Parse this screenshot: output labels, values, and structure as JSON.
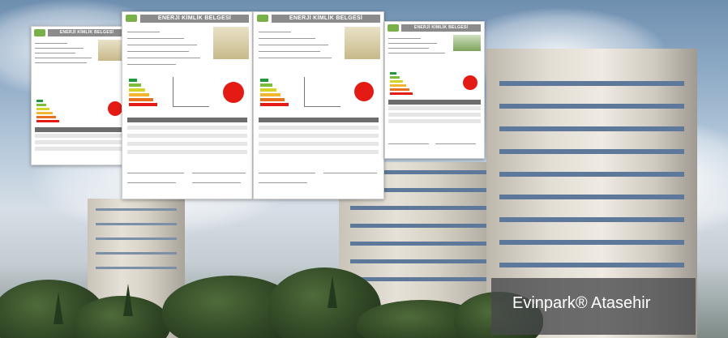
{
  "certificates": [
    {
      "header": "ENERJİ KİMLİK BELGESİ"
    },
    {
      "header": "ENERJİ KİMLİK BELGESİ"
    },
    {
      "header": "ENERJİ KİMLİK BELGESİ"
    },
    {
      "header": "ENERJİ KİMLİK BELGESİ"
    }
  ],
  "caption": {
    "text": "Evinpark® Atasehir"
  },
  "colors": {
    "rating_red": "#e31b14",
    "header_gray": "#8b8b8b",
    "caption_bg": "#46484a"
  }
}
